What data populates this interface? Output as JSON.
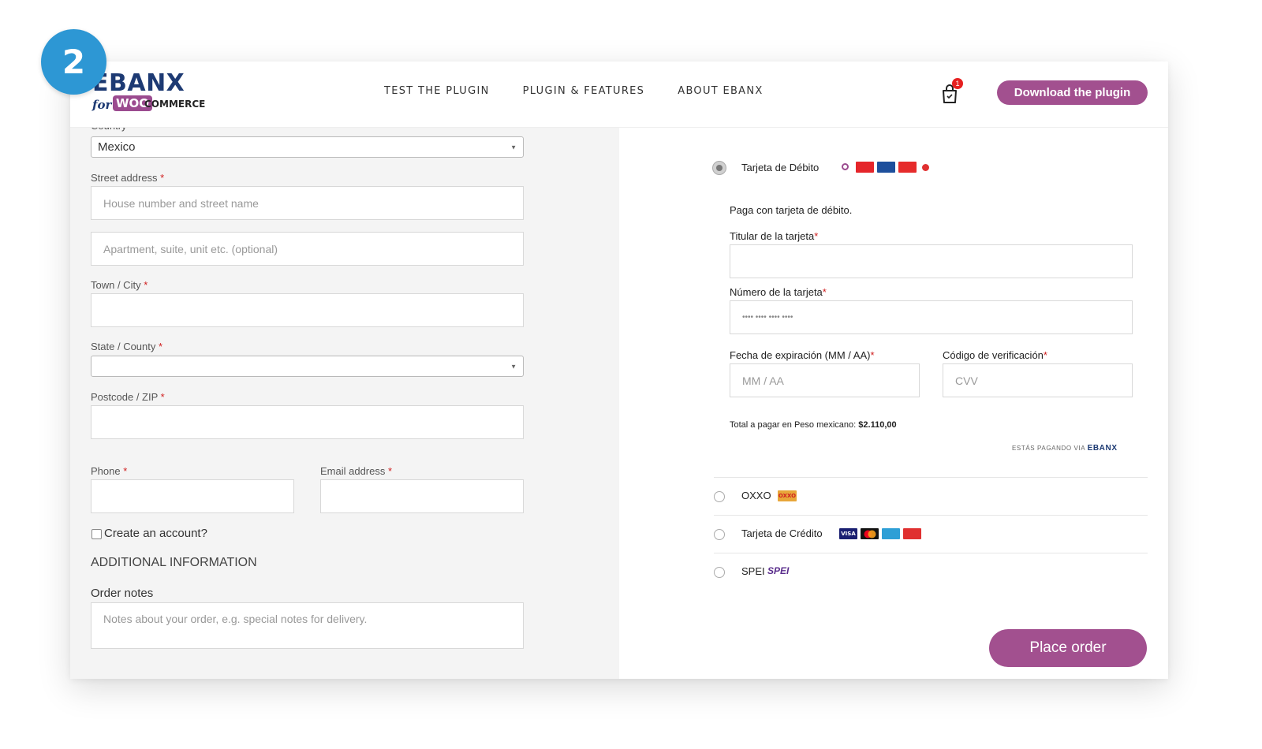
{
  "step": "2",
  "brand": {
    "name": "EBANX",
    "for_text": "for",
    "woo": "WOO",
    "commerce": "COMMERCE"
  },
  "nav": [
    "TEST THE PLUGIN",
    "PLUGIN & FEATURES",
    "ABOUT EBANX"
  ],
  "cart": {
    "count": "1"
  },
  "download_label": "Download the plugin",
  "billing": {
    "country_label": "Country",
    "country_value": "Mexico",
    "street_label": "Street address",
    "street_placeholder": "House number and street name",
    "street2_placeholder": "Apartment, suite, unit etc. (optional)",
    "city_label": "Town / City",
    "state_label": "State / County",
    "postcode_label": "Postcode / ZIP",
    "phone_label": "Phone",
    "email_label": "Email address",
    "required_mark": "*",
    "create_account_label": "Create an account?",
    "additional_title": "ADDITIONAL INFORMATION",
    "order_notes_label": "Order notes",
    "order_notes_placeholder": "Notes about your order, e.g. special notes for delivery."
  },
  "payment": {
    "debit": {
      "name": "Tarjeta de Débito",
      "description": "Paga con tarjeta de débito.",
      "holder_label": "Titular de la tarjeta",
      "number_label": "Número de la tarjeta",
      "number_placeholder": "•••• •••• •••• ••••",
      "expiry_label": "Fecha de expiración (MM / AA)",
      "expiry_placeholder": "MM / AA",
      "cvv_label": "Código de verificación",
      "cvv_placeholder": "CVV",
      "total_text": "Total a pagar en Peso mexicano:",
      "total_amount": "$2.110,00",
      "via_text": "ESTÁS PAGANDO VIA",
      "via_brand": "EBANX"
    },
    "oxxo": {
      "name": "OXXO",
      "badge": "OXXO"
    },
    "credit": {
      "name": "Tarjeta de Crédito",
      "badge_visa": "VISA"
    },
    "spei": {
      "name": "SPEI",
      "badge": "SPEI"
    }
  },
  "place_order_label": "Place order",
  "colors": {
    "accent": "#a2508f",
    "step_badge": "#2d97d4",
    "brand_blue": "#1d3a73",
    "required": "#d02020"
  }
}
